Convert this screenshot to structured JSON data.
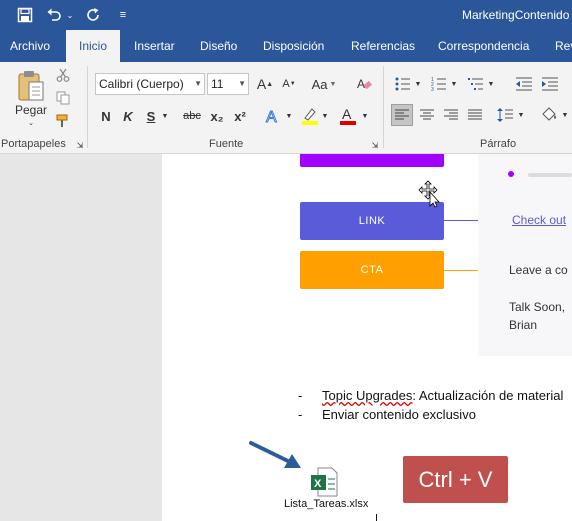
{
  "titlebar": {
    "title": "MarketingContenido",
    "icons": [
      "save-icon",
      "undo-icon",
      "redo-icon",
      "customize-qat-icon"
    ]
  },
  "tabs": [
    "Archivo",
    "Inicio",
    "Insertar",
    "Diseño",
    "Disposición",
    "Referencias",
    "Correspondencia",
    "Rev"
  ],
  "active_tab": "Inicio",
  "ribbon": {
    "clipboard": {
      "paste_label": "Pegar",
      "group_label": "Portapapeles"
    },
    "font": {
      "font_name": "Calibri (Cuerpo)",
      "font_size": "11",
      "bold": "N",
      "italic": "K",
      "underline": "S",
      "strike": "abc",
      "subscript": "x₂",
      "superscript": "x²",
      "grow": "A",
      "shrink": "A",
      "case": "Aa",
      "group_label": "Fuente"
    },
    "paragraph": {
      "group_label": "Párrafo"
    }
  },
  "document": {
    "flow_boxes": [
      {
        "label": "",
        "color": "#a200ff"
      },
      {
        "label": "LINK",
        "color": "#5a5bd8"
      },
      {
        "label": "CTA",
        "color": "#ffa000"
      }
    ],
    "email_preview": {
      "link_text": "Check out",
      "cta_text": "Leave a co",
      "signoff": "Talk Soon,",
      "name": "Brian"
    },
    "bullets": [
      {
        "prefix": "Topic Upgrades",
        "rest": ": Actualización de material"
      },
      {
        "prefix": "",
        "rest": "Enviar contenido exclusivo"
      }
    ],
    "file_name": "Lista_Tareas.xlsx"
  },
  "overlay": {
    "shortcut_label": "Ctrl + V",
    "color": "#c0504d"
  },
  "colors": {
    "ribbon_blue": "#2b579a",
    "ribbon_bg": "#f3f3f3",
    "link_blue": "#5a5bd8",
    "excel_green": "#217346",
    "arrow_blue": "#2e5c9a"
  }
}
